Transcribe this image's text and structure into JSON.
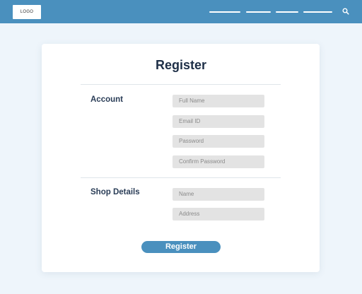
{
  "header": {
    "logo_text": "LOGO",
    "nav_items": [
      "",
      "",
      "",
      ""
    ],
    "search_icon": "search-icon",
    "accent_color": "#4a90be"
  },
  "form": {
    "title": "Register",
    "sections": [
      {
        "label": "Account",
        "fields": [
          {
            "placeholder": "Full Name"
          },
          {
            "placeholder": "Email ID"
          },
          {
            "placeholder": "Password"
          },
          {
            "placeholder": "Confirm Password"
          }
        ]
      },
      {
        "label": "Shop Details",
        "fields": [
          {
            "placeholder": "Name"
          },
          {
            "placeholder": "Address"
          }
        ]
      }
    ],
    "submit_label": "Register"
  }
}
